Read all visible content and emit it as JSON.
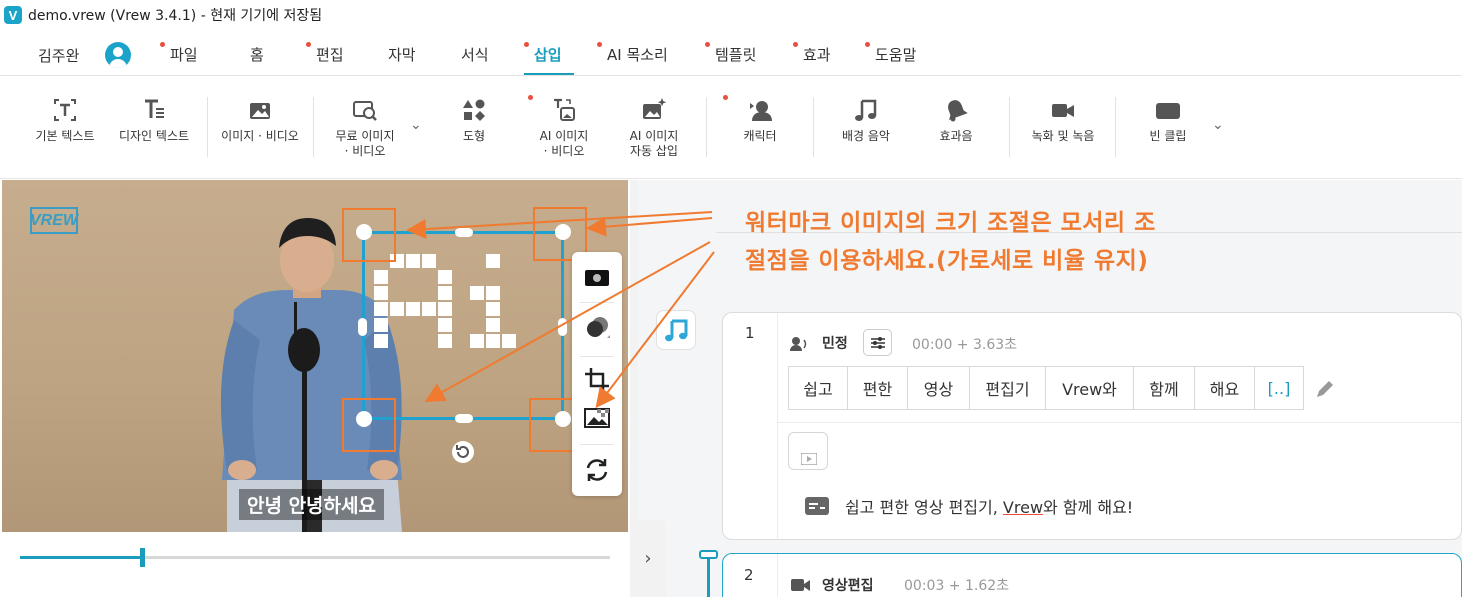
{
  "titlebar": {
    "logo": "V",
    "title": "demo.vrew (Vrew 3.4.1) - 현재 기기에 저장됨"
  },
  "user": {
    "name": "김주완"
  },
  "menu": [
    {
      "label": "파일",
      "dot": true
    },
    {
      "label": "홈",
      "dot": false
    },
    {
      "label": "편집",
      "dot": true
    },
    {
      "label": "자막",
      "dot": false
    },
    {
      "label": "서식",
      "dot": false
    },
    {
      "label": "삽입",
      "dot": true,
      "active": true
    },
    {
      "label": "AI 목소리",
      "dot": true
    },
    {
      "label": "템플릿",
      "dot": true
    },
    {
      "label": "효과",
      "dot": true
    },
    {
      "label": "도움말",
      "dot": true
    }
  ],
  "toolbar": {
    "basic_text": "기본 텍스트",
    "design_text": "디자인 텍스트",
    "image_video": "이미지 · 비디오",
    "free_image_video_1": "무료 이미지",
    "free_image_video_2": "· 비디오",
    "shape": "도형",
    "ai_image_video_1": "AI 이미지",
    "ai_image_video_2": "· 비디오",
    "ai_image_auto_1": "AI 이미지",
    "ai_image_auto_2": "자동 삽입",
    "character": "캐릭터",
    "bgm": "배경 음악",
    "sfx": "효과음",
    "record": "녹화 및 녹음",
    "empty_clip": "빈 클립"
  },
  "preview": {
    "watermark_logo": "VREW",
    "pixel_art_text": "Ai",
    "subtitle": "안녕 안녕하세요",
    "progress": 0.2
  },
  "callout": {
    "line1": "워터마크 이미지의 크기 조절은 모서리 조",
    "line2": "절점을 이용하세요.(가로세로 비율 유지)",
    "color": "#f07a30"
  },
  "clip1": {
    "number": "1",
    "speaker": "민정",
    "timecode": "00:00 + 3.63초",
    "words": [
      "쉽고",
      "편한",
      "영상",
      "편집기",
      "Vrew와",
      "함께",
      "해요",
      "[..]"
    ],
    "subtitle_pre": "쉽고 편한 영상 편집기, ",
    "subtitle_mark": "Vrew",
    "subtitle_post": "와 함께 해요!"
  },
  "clip2": {
    "number": "2",
    "speaker": "영상편집",
    "timecode": "00:03 + 1.62초"
  },
  "colors": {
    "accent": "#1a9dbd",
    "notify": "#e94f3d",
    "annotation": "#f07a30"
  }
}
